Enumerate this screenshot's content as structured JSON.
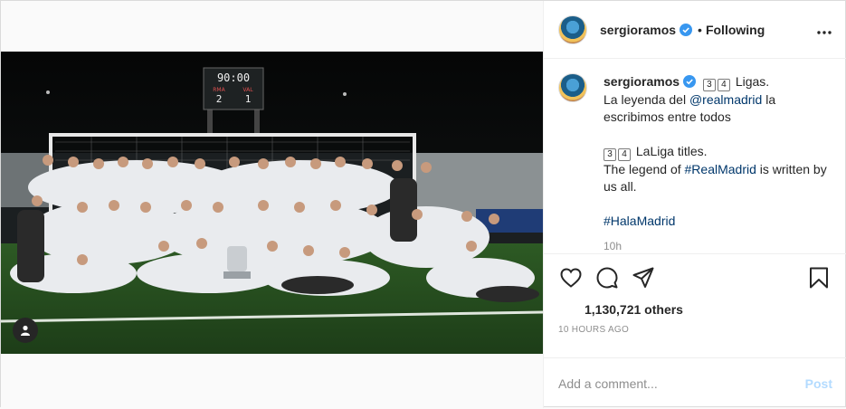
{
  "header": {
    "username": "sergioramos",
    "separator": "•",
    "follow_status": "Following",
    "more_icon": "more-horizontal-icon"
  },
  "caption": {
    "username": "sergioramos",
    "num_a": "3",
    "num_b": "4",
    "line1_rest": "Ligas.",
    "line2_pre": "La leyenda del ",
    "line2_mention": "@realmadrid",
    "line2_post": " la escribimos entre todos",
    "en_num_a": "3",
    "en_num_b": "4",
    "en_line1_rest": "LaLiga titles.",
    "en_line2_pre": "The legend of ",
    "en_line2_hashtag": "#RealMadrid",
    "en_line2_post": " is written by us all.",
    "hashtag": "#HalaMadrid",
    "time_ago": "10h"
  },
  "photo": {
    "scoreboard_time": "90:00",
    "home_team": "RMA",
    "away_team": "VAL",
    "home_score": "2",
    "away_score": "1"
  },
  "actions": {
    "like_icon": "heart-icon",
    "comment_icon": "comment-icon",
    "share_icon": "share-icon",
    "save_icon": "bookmark-icon"
  },
  "likes": {
    "count_text": "1,130,721 others"
  },
  "timestamp": "10 HOURS AGO",
  "comment": {
    "placeholder": "Add a comment...",
    "post_label": "Post"
  },
  "colors": {
    "verified": "#3897f0",
    "link": "#00376b",
    "post_disabled": "#b3dbff",
    "muted": "#8e8e8e"
  }
}
